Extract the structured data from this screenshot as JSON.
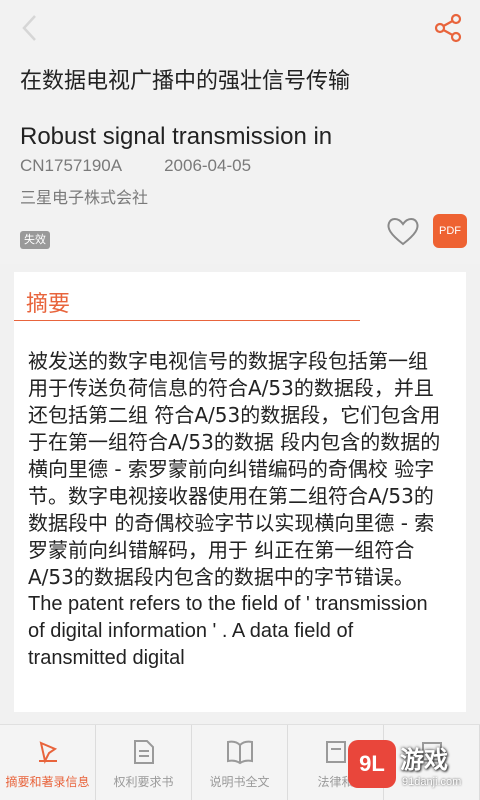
{
  "patent": {
    "title_cn": "在数据电视广播中的强壮信号传输",
    "title_en": "Robust signal transmission in",
    "number": "CN1757190A",
    "date": "2006-04-05",
    "applicant": "三星电子株式会社",
    "status": "失效"
  },
  "actions": {
    "pdf_label": "PDF"
  },
  "abstract": {
    "heading": "摘要",
    "text_cn": "被发送的数字电视信号的数据字段包括第一组 用于传送负荷信息的符合A/53的数据段，并且还包括第二组 符合A/53的数据段，它们包含用于在第一组符合A/53的数据 段内包含的数据的横向里德 - 索罗蒙前向纠错编码的奇偶校 验字节。数字电视接收器使用在第二组符合A/53的数据段中 的奇偶校验字节以实现横向里德 - 索罗蒙前向纠错解码，用于 纠正在第一组符合A/53的数据段内包含的数据中的字节错误。",
    "text_en": "The patent refers to the field of ' transmission of digital information ' . A data field of transmitted digital"
  },
  "tabs": [
    {
      "label": "摘要和著录信息",
      "icon": "tag-icon",
      "active": true
    },
    {
      "label": "权利要求书",
      "icon": "document-icon",
      "active": false
    },
    {
      "label": "说明书全文",
      "icon": "book-icon",
      "active": false
    },
    {
      "label": "法律和",
      "icon": "law-icon",
      "active": false
    },
    {
      "label": "",
      "icon": "more-icon",
      "active": false
    }
  ],
  "watermark": {
    "logo": "9L",
    "name": "游戏",
    "url": "91danji.com"
  },
  "colors": {
    "accent": "#e8643c",
    "pdf": "#ee6232",
    "badge": "#999999"
  }
}
